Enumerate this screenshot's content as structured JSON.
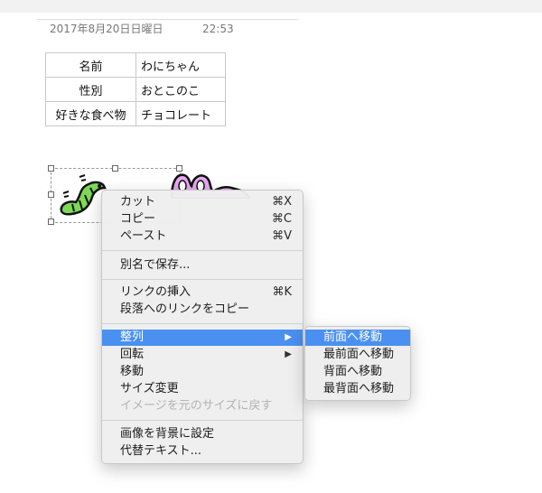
{
  "header": {
    "date": "2017年8月20日日曜日",
    "time": "22:53"
  },
  "table": {
    "rows": [
      [
        "名前",
        "わにちゃん"
      ],
      [
        "性別",
        "おとこのこ"
      ],
      [
        "好きな食べ物",
        "チョコレート"
      ]
    ]
  },
  "context_menu": {
    "cut": "カット",
    "cut_shortcut": "⌘X",
    "copy": "コピー",
    "copy_shortcut": "⌘C",
    "paste": "ペースト",
    "paste_shortcut": "⌘V",
    "save_as": "別名で保存...",
    "insert_link": "リンクの挿入",
    "insert_link_shortcut": "⌘K",
    "copy_paragraph_link": "段落へのリンクをコピー",
    "arrange": "整列",
    "rotate": "回転",
    "move": "移動",
    "resize": "サイズ変更",
    "reset_size": "イメージを元のサイズに戻す",
    "set_background": "画像を背景に設定",
    "alt_text": "代替テキスト..."
  },
  "arrange_submenu": {
    "bring_forward": "前面へ移動",
    "bring_to_front": "最前面へ移動",
    "send_backward": "背面へ移動",
    "send_to_back": "最背面へ移動"
  },
  "colors": {
    "highlight": "#4a90f0",
    "worm_green": "#7ed957",
    "purple_creature": "#e6a8f0"
  }
}
